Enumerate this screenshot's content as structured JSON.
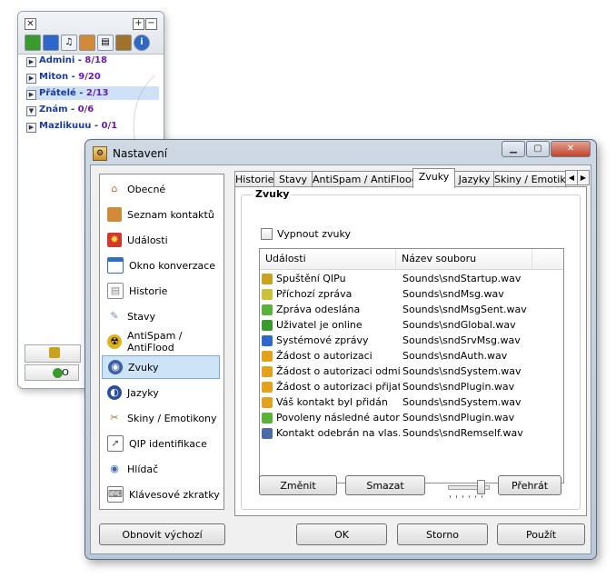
{
  "qip": {
    "close_glyph": "✕",
    "maximize_glyph": "+",
    "minimize_glyph": "−",
    "toolbar_icons": [
      "status-icon",
      "window-icon",
      "music-icon",
      "pen-icon",
      "history-icon",
      "tools-icon",
      "info-icon"
    ],
    "groups": [
      {
        "name": "Admini",
        "count": "8/18",
        "selected": false
      },
      {
        "name": "Miton",
        "count": "9/20",
        "selected": false
      },
      {
        "name": "Přátelé",
        "count": "2/13",
        "selected": true
      },
      {
        "name": "Znám",
        "count": "0/6",
        "selected": false
      },
      {
        "name": "Mazlikuuu",
        "count": "0/1",
        "selected": false
      }
    ],
    "bottom_button_text": "O"
  },
  "dialog": {
    "title": "Nastavení",
    "nav": [
      {
        "label": "Obecné",
        "icon": "home-icon",
        "color": "#c46a2b"
      },
      {
        "label": "Seznam kontaktů",
        "icon": "contacts-icon",
        "color": "#d08a3a"
      },
      {
        "label": "Události",
        "icon": "events-icon",
        "color": "#d03a2a"
      },
      {
        "label": "Okno konverzace",
        "icon": "chat-window-icon",
        "color": "#2e6fc4"
      },
      {
        "label": "Historie",
        "icon": "history-icon",
        "color": "#8a8a8a"
      },
      {
        "label": "Stavy",
        "icon": "status-icon",
        "color": "#6a8fb8"
      },
      {
        "label": "AntiSpam / AntiFlood",
        "icon": "radiation-icon",
        "color": "#e0b31e"
      },
      {
        "label": "Zvuky",
        "icon": "sounds-icon",
        "color": "#3b5fa8"
      },
      {
        "label": "Jazyky",
        "icon": "languages-icon",
        "color": "#2a4f9c"
      },
      {
        "label": "Skiny / Emotikony",
        "icon": "skins-icon",
        "color": "#a0722c"
      },
      {
        "label": "QIP identifikace",
        "icon": "identification-icon",
        "color": "#777777"
      },
      {
        "label": "Hlídač",
        "icon": "eye-icon",
        "color": "#3a6aa8"
      },
      {
        "label": "Klávesové zkratky",
        "icon": "shortcuts-icon",
        "color": "#777777"
      }
    ],
    "selected_nav": "Zvuky",
    "tabs": [
      "Historie",
      "Stavy",
      "AntiSpam / AntiFlood",
      "Zvuky",
      "Jazyky",
      "Skiny / Emotik"
    ],
    "active_tab": "Zvuky",
    "section_title": "Zvuky",
    "mute_label": "Vypnout zvuky",
    "mute_checked": false,
    "columns": [
      "Události",
      "Název souboru"
    ],
    "rows": [
      {
        "event": "Spuštění QIPu",
        "file": "Sounds\\sndStartup.wav",
        "icon": "qip-startup-icon",
        "color": "#c9a21f"
      },
      {
        "event": "Příchozí zpráva",
        "file": "Sounds\\sndMsg.wav",
        "icon": "incoming-message-icon",
        "color": "#c9c23a"
      },
      {
        "event": "Zpráva odeslána",
        "file": "Sounds\\sndMsgSent.wav",
        "icon": "sent-message-icon",
        "color": "#5ab23a"
      },
      {
        "event": "Uživatel je online",
        "file": "Sounds\\sndGlobal.wav",
        "icon": "user-online-icon",
        "color": "#3b9a2e"
      },
      {
        "event": "Systémové zprávy",
        "file": "Sounds\\sndSrvMsg.wav",
        "icon": "system-info-icon",
        "color": "#2d67c9"
      },
      {
        "event": "Žádost o autorizaci",
        "file": "Sounds\\sndAuth.wav",
        "icon": "auth-request-icon",
        "color": "#e3a21d"
      },
      {
        "event": "Žádost o autorizaci odmí...",
        "file": "Sounds\\sndSystem.wav",
        "icon": "auth-denied-icon",
        "color": "#e3a21d"
      },
      {
        "event": "Žádost o autorizaci přijata",
        "file": "Sounds\\sndPlugin.wav",
        "icon": "auth-accepted-icon",
        "color": "#e3a21d"
      },
      {
        "event": "Váš kontakt byl přidán",
        "file": "Sounds\\sndSystem.wav",
        "icon": "contact-added-icon",
        "color": "#e3a21d"
      },
      {
        "event": "Povoleny následné autor...",
        "file": "Sounds\\sndPlugin.wav",
        "icon": "auth-allowed-icon",
        "color": "#5ab23a"
      },
      {
        "event": "Kontakt odebrán na vlas...",
        "file": "Sounds\\sndRemself.wav",
        "icon": "contact-removed-icon",
        "color": "#4a6aa8"
      }
    ],
    "buttons": {
      "change": "Změnit",
      "delete": "Smazat",
      "play": "Přehrát",
      "restore_defaults": "Obnovit výchozí",
      "ok": "OK",
      "cancel": "Storno",
      "apply": "Použít"
    },
    "volume_level": 0.85
  }
}
